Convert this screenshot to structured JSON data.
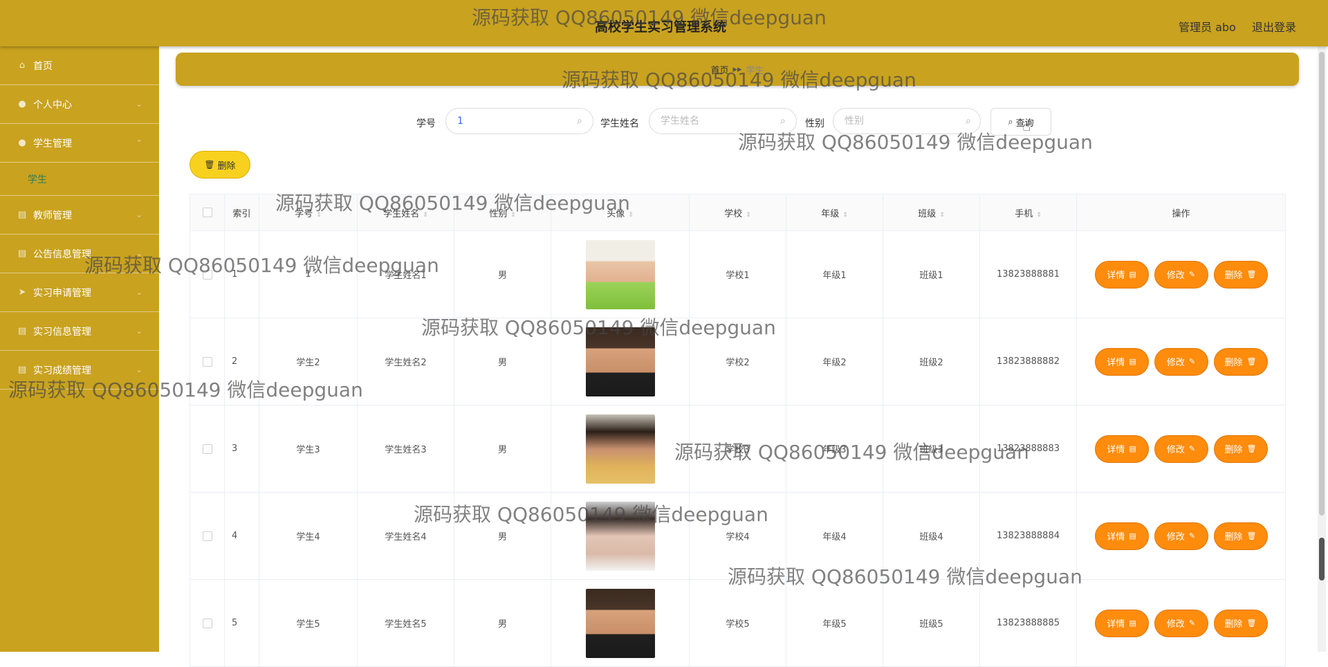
{
  "header": {
    "title": "高校学生实习管理系统",
    "user": "管理员 abo",
    "logout": "退出登录"
  },
  "sidebar": {
    "items": [
      {
        "label": "首页",
        "icon": "home-icon"
      },
      {
        "label": "个人中心",
        "icon": "user-icon"
      },
      {
        "label": "学生管理",
        "icon": "user-icon"
      },
      {
        "label": "学生",
        "icon": ""
      },
      {
        "label": "教师管理",
        "icon": "list-icon"
      },
      {
        "label": "公告信息管理",
        "icon": "list-icon"
      },
      {
        "label": "实习申请管理",
        "icon": "send-icon"
      },
      {
        "label": "实习信息管理",
        "icon": "list-icon"
      },
      {
        "label": "实习成绩管理",
        "icon": "list-icon"
      }
    ]
  },
  "breadcrumb": {
    "home": "首页",
    "current": "学生"
  },
  "search": {
    "fields": [
      {
        "label": "学号",
        "value": "1",
        "placeholder": ""
      },
      {
        "label": "学生姓名",
        "value": "",
        "placeholder": "学生姓名"
      },
      {
        "label": "性别",
        "value": "",
        "placeholder": "性别"
      }
    ],
    "query_label": "查询"
  },
  "toolbar": {
    "delete_label": "删除"
  },
  "table": {
    "columns": [
      "索引",
      "学号",
      "学生姓名",
      "性别",
      "头像",
      "学校",
      "年级",
      "班级",
      "手机",
      "操作"
    ],
    "rows": [
      {
        "index": "1",
        "id": "1",
        "name": "学生姓名1",
        "gender": "男",
        "school": "学校1",
        "grade": "年级1",
        "class": "班级1",
        "phone": "13823888881"
      },
      {
        "index": "2",
        "id": "学生2",
        "name": "学生姓名2",
        "gender": "男",
        "school": "学校2",
        "grade": "年级2",
        "class": "班级2",
        "phone": "13823888882"
      },
      {
        "index": "3",
        "id": "学生3",
        "name": "学生姓名3",
        "gender": "男",
        "school": "学校3",
        "grade": "年级3",
        "class": "班级3",
        "phone": "13823888883"
      },
      {
        "index": "4",
        "id": "学生4",
        "name": "学生姓名4",
        "gender": "男",
        "school": "学校4",
        "grade": "年级4",
        "class": "班级4",
        "phone": "13823888884"
      },
      {
        "index": "5",
        "id": "学生5",
        "name": "学生姓名5",
        "gender": "男",
        "school": "学校5",
        "grade": "年级5",
        "class": "班级5",
        "phone": "13823888885"
      }
    ],
    "actions": {
      "detail": "详情",
      "edit": "修改",
      "delete": "删除"
    }
  },
  "watermark": "源码获取 QQ86050149 微信deepguan",
  "colors": {
    "theme": "#c9a21f",
    "action": "#ff8c0c",
    "batch_delete": "#f7d11e",
    "active_submenu": "#2c7d5b"
  }
}
